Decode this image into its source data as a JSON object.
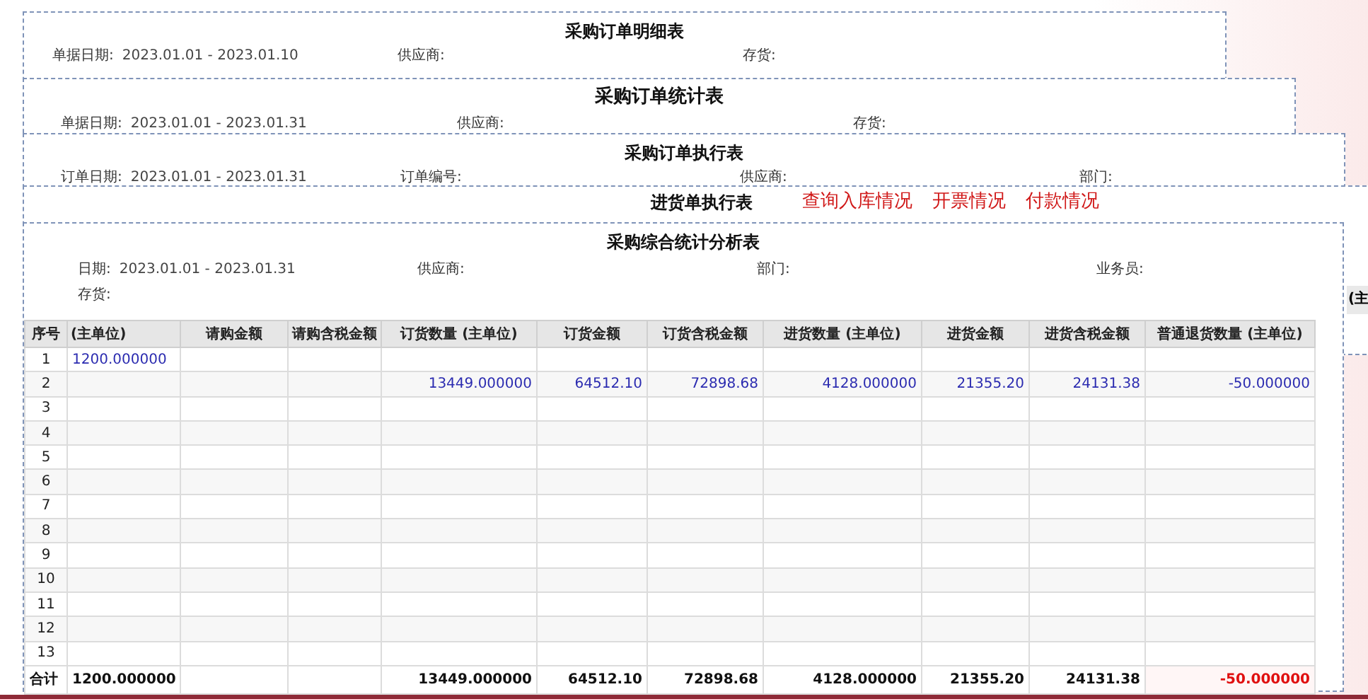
{
  "reports": [
    {
      "title": "采购订单明细表",
      "filters": [
        {
          "label": "单据日期:",
          "value": "2023.01.01 - 2023.01.10"
        },
        {
          "label": "供应商:"
        },
        {
          "label": "存货:"
        }
      ]
    },
    {
      "title": "采购订单统计表",
      "filters": [
        {
          "label": "单据日期:",
          "value": "2023.01.01 - 2023.01.31"
        },
        {
          "label": "供应商:"
        },
        {
          "label": "存货:"
        }
      ]
    },
    {
      "title": "采购订单执行表",
      "filters": [
        {
          "label": "订单日期:",
          "value": "2023.01.01 - 2023.01.31"
        },
        {
          "label": "订单编号:"
        },
        {
          "label": "供应商:"
        },
        {
          "label": "部门:"
        }
      ]
    },
    {
      "title": "进货单执行表",
      "links": [
        "查询入库情况",
        "开票情况",
        "付款情况"
      ],
      "column_1": "(主"
    },
    {
      "title": "采购综合统计分析表",
      "filters": [
        {
          "label": "日期:",
          "value": "2023.01.01 - 2023.01.31"
        },
        {
          "label": "供应商:"
        },
        {
          "label": "部门:"
        },
        {
          "label": "业务员:"
        },
        {
          "label": "存货:"
        }
      ],
      "table": {
        "columns": [
          "序号",
          "(主单位)",
          "请购金额",
          "请购含税金额",
          "订货数量 (主单位)",
          "订货金额",
          "订货含税金额",
          "进货数量 (主单位)",
          "进货金额",
          "进货含税金额",
          "普通退货数量 (主单位)"
        ],
        "rows": [
          [
            "1",
            "1200.000000",
            null,
            null,
            null,
            null,
            null,
            null,
            null,
            null,
            null
          ],
          [
            "2",
            null,
            null,
            null,
            "13449.000000",
            "64512.10",
            "72898.68",
            "4128.000000",
            "21355.20",
            "24131.38",
            "-50.000000"
          ],
          [
            "3",
            null,
            null,
            null,
            null,
            null,
            null,
            null,
            null,
            null,
            null
          ],
          [
            "4",
            null,
            null,
            null,
            null,
            null,
            null,
            null,
            null,
            null,
            null
          ],
          [
            "5",
            null,
            null,
            null,
            null,
            null,
            null,
            null,
            null,
            null,
            null
          ],
          [
            "6",
            null,
            null,
            null,
            null,
            null,
            null,
            null,
            null,
            null,
            null
          ],
          [
            "7",
            null,
            null,
            null,
            null,
            null,
            null,
            null,
            null,
            null,
            null
          ],
          [
            "8",
            null,
            null,
            null,
            null,
            null,
            null,
            null,
            null,
            null,
            null
          ],
          [
            "9",
            null,
            null,
            null,
            null,
            null,
            null,
            null,
            null,
            null,
            null
          ],
          [
            "10",
            null,
            null,
            null,
            null,
            null,
            null,
            null,
            null,
            null,
            null
          ],
          [
            "11",
            null,
            null,
            null,
            null,
            null,
            null,
            null,
            null,
            null,
            null
          ],
          [
            "12",
            null,
            null,
            null,
            null,
            null,
            null,
            null,
            null,
            null,
            null
          ],
          [
            "13",
            null,
            null,
            null,
            null,
            null,
            null,
            null,
            null,
            null,
            null
          ],
          [
            "合计",
            "1200.000000",
            null,
            null,
            "13449.000000",
            "64512.10",
            "72898.68",
            "4128.000000",
            "21355.20",
            "24131.38",
            "-50.000000"
          ]
        ],
        "totals_alert": [
          false,
          false,
          false,
          false,
          false,
          false,
          false,
          false,
          false,
          false,
          true
        ]
      }
    }
  ]
}
